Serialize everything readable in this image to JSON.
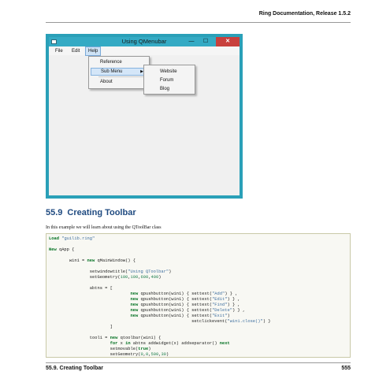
{
  "running_head": "Ring Documentation, Release 1.5.2",
  "app": {
    "title": "Using QMenubar",
    "controls": {
      "minimize": "—",
      "maximize": "☐",
      "close": "✕"
    },
    "menubar": [
      "File",
      "Edit",
      "Help"
    ],
    "help_menu": {
      "reference": "Reference",
      "submenu": "Sub Menu",
      "about": "About"
    },
    "sub_menu": [
      "Website",
      "Forum",
      "Blog"
    ],
    "colors": {
      "frame": "#2aa0b8",
      "close": "#c8403d"
    }
  },
  "section": {
    "number": "55.9",
    "title": "Creating Toolbar"
  },
  "intro": "In this example we will learn about using the QToolBar class",
  "code": [
    [
      {
        "t": "Load",
        "c": "kw"
      },
      {
        "t": " "
      },
      {
        "t": "\"guilib.ring\"",
        "c": "str"
      }
    ],
    [],
    [
      {
        "t": "New",
        "c": "kw"
      },
      {
        "t": " qApp {"
      }
    ],
    [],
    [
      {
        "t": "        win1 = "
      },
      {
        "t": "new",
        "c": "kw"
      },
      {
        "t": " qMainWindow() {"
      }
    ],
    [],
    [
      {
        "t": "                setwindowtitle("
      },
      {
        "t": "\"Using QToolbar\"",
        "c": "str"
      },
      {
        "t": ")"
      }
    ],
    [
      {
        "t": "                setGeometry("
      },
      {
        "t": "100",
        "c": "num-lit"
      },
      {
        "t": ","
      },
      {
        "t": "100",
        "c": "num-lit"
      },
      {
        "t": ","
      },
      {
        "t": "600",
        "c": "num-lit"
      },
      {
        "t": ","
      },
      {
        "t": "400",
        "c": "num-lit"
      },
      {
        "t": ")"
      }
    ],
    [],
    [
      {
        "t": "                abtns = ["
      }
    ],
    [
      {
        "t": "                                "
      },
      {
        "t": "new",
        "c": "kw"
      },
      {
        "t": " qpushbutton(win1) { settext("
      },
      {
        "t": "\"Add\"",
        "c": "str"
      },
      {
        "t": ") } ,"
      }
    ],
    [
      {
        "t": "                                "
      },
      {
        "t": "new",
        "c": "kw"
      },
      {
        "t": " qpushbutton(win1) { settext("
      },
      {
        "t": "\"Edit\"",
        "c": "str"
      },
      {
        "t": ") } ,"
      }
    ],
    [
      {
        "t": "                                "
      },
      {
        "t": "new",
        "c": "kw"
      },
      {
        "t": " qpushbutton(win1) { settext("
      },
      {
        "t": "\"Find\"",
        "c": "str"
      },
      {
        "t": ") } ,"
      }
    ],
    [
      {
        "t": "                                "
      },
      {
        "t": "new",
        "c": "kw"
      },
      {
        "t": " qpushbutton(win1) { settext("
      },
      {
        "t": "\"Delete\"",
        "c": "str"
      },
      {
        "t": ") } ,"
      }
    ],
    [
      {
        "t": "                                "
      },
      {
        "t": "new",
        "c": "kw"
      },
      {
        "t": " qpushbutton(win1) { settext("
      },
      {
        "t": "\"Exit\"",
        "c": "str"
      },
      {
        "t": ")"
      }
    ],
    [
      {
        "t": "                                                        setclickevent("
      },
      {
        "t": "\"win1.close()\"",
        "c": "str"
      },
      {
        "t": ") }"
      }
    ],
    [
      {
        "t": "                        ]"
      }
    ],
    [],
    [
      {
        "t": "                tool1 = "
      },
      {
        "t": "new",
        "c": "kw"
      },
      {
        "t": " qtoolbar(win1) {"
      }
    ],
    [
      {
        "t": "                        "
      },
      {
        "t": "for",
        "c": "kw"
      },
      {
        "t": " x "
      },
      {
        "t": "in",
        "c": "kw"
      },
      {
        "t": " abtns addwidget(x) addseparator() "
      },
      {
        "t": "next",
        "c": "kw"
      }
    ],
    [
      {
        "t": "                        setmovable("
      },
      {
        "t": "true",
        "c": "kw"
      },
      {
        "t": ")"
      }
    ],
    [
      {
        "t": "                        setGeometry("
      },
      {
        "t": "0",
        "c": "num-lit"
      },
      {
        "t": ","
      },
      {
        "t": "0",
        "c": "num-lit"
      },
      {
        "t": ","
      },
      {
        "t": "500",
        "c": "num-lit"
      },
      {
        "t": ","
      },
      {
        "t": "30",
        "c": "num-lit"
      },
      {
        "t": ")"
      }
    ]
  ],
  "footer": {
    "section": "55.9.  Creating Toolbar",
    "page": "555"
  }
}
